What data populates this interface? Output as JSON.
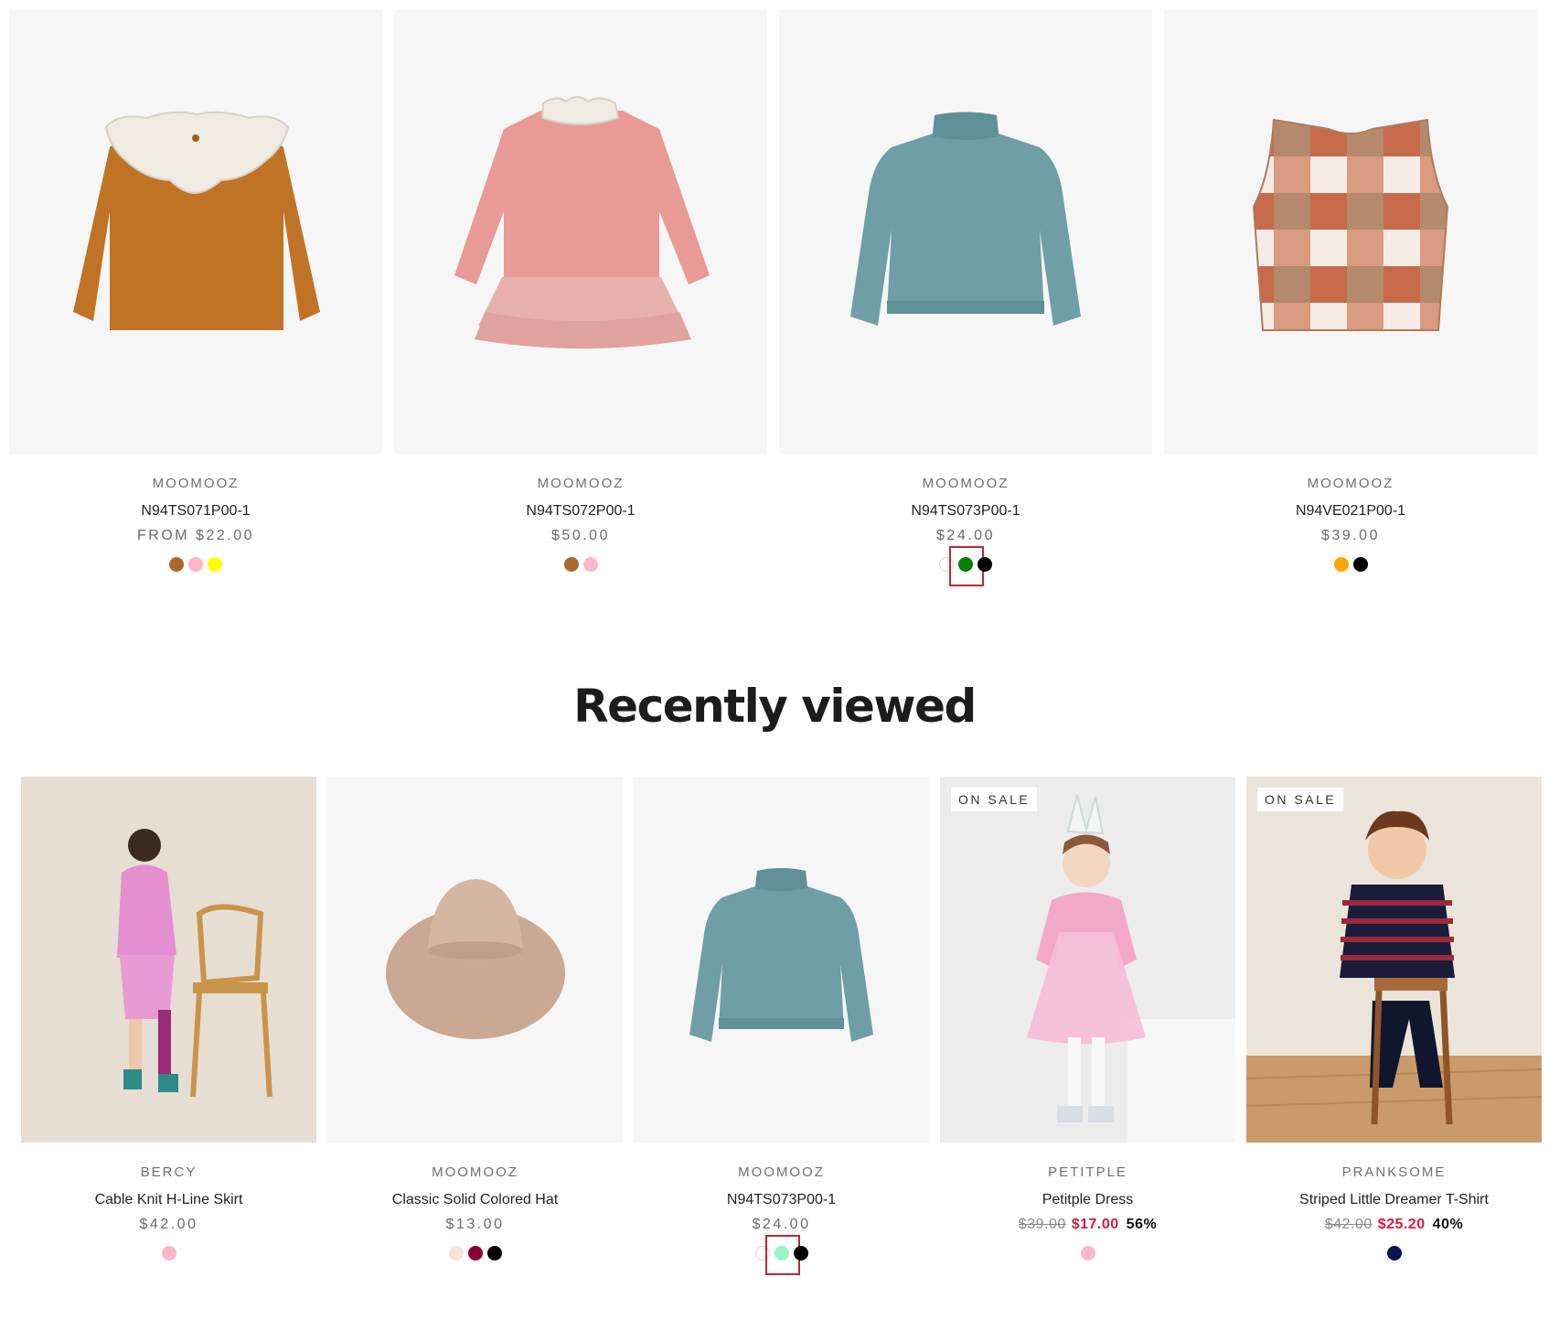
{
  "featured_products": [
    {
      "vendor": "MOOMOOZ",
      "title": "N94TS071P00-1",
      "price": "FROM $22.00",
      "image": "ruffle-collar-top-icon",
      "swatches": [
        "#a86a2a",
        "#ffb6c8",
        "#ffff00"
      ]
    },
    {
      "vendor": "MOOMOOZ",
      "title": "N94TS072P00-1",
      "price": "$50.00",
      "image": "ruffle-dress-icon",
      "swatches": [
        "#a86a2a",
        "#ffb6c8"
      ]
    },
    {
      "vendor": "MOOMOOZ",
      "title": "N94TS073P00-1",
      "price": "$24.00",
      "image": "turtleneck-sweater-icon",
      "swatches": [
        "#ffffff",
        "#008000",
        "#000000"
      ],
      "highlighted_swatch": 1
    },
    {
      "vendor": "MOOMOOZ",
      "title": "N94VE021P00-1",
      "price": "$39.00",
      "image": "plaid-vest-icon",
      "swatches": [
        "#ffa500",
        "#000000"
      ]
    }
  ],
  "recently_viewed": {
    "heading": "Recently viewed",
    "products": [
      {
        "vendor": "BERCY",
        "title": "Cable Knit H-Line Skirt",
        "price": "$42.00",
        "image": "girl-pink-knit-photo",
        "swatches": [
          "#ffb6c8"
        ]
      },
      {
        "vendor": "MOOMOOZ",
        "title": "Classic Solid Colored Hat",
        "price": "$13.00",
        "image": "felt-hat-icon",
        "swatches": [
          "#f5e3d8",
          "#8b0032",
          "#000000"
        ]
      },
      {
        "vendor": "MOOMOOZ",
        "title": "N94TS073P00-1",
        "price": "$24.00",
        "image": "turtleneck-sweater-icon",
        "swatches": [
          "#ffffff",
          "#98f5c8",
          "#000000"
        ],
        "highlighted_swatch": 1
      },
      {
        "vendor": "PETITPLE",
        "title": "Petitple Dress",
        "badge": "ON SALE",
        "compare_price": "$39.00",
        "sale_price": "$17.00",
        "discount": "56%",
        "image": "girl-pink-tutu-photo",
        "swatches": [
          "#ffb6c8"
        ]
      },
      {
        "vendor": "PRANKSOME",
        "title": "Striped Little Dreamer T-Shirt",
        "badge": "ON SALE",
        "compare_price": "$42.00",
        "sale_price": "$25.20",
        "discount": "40%",
        "image": "boy-striped-shirt-photo",
        "swatches": [
          "#0a1450"
        ]
      }
    ]
  }
}
